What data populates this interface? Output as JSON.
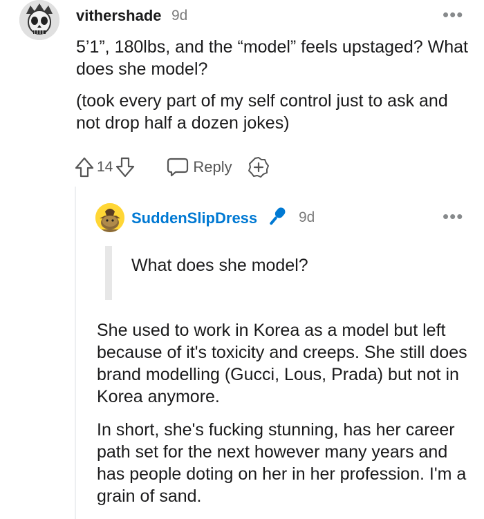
{
  "parent_comment": {
    "username": "vithershade",
    "time": "9d",
    "more_label": "•••",
    "paragraphs": [
      "5’1”, 180lbs, and the “model” feels upstaged? What does she model?",
      "(took every part of my self control just to ask and not drop half a dozen jokes)"
    ],
    "score": "14",
    "reply_label": "Reply",
    "icons": {
      "avatar": "skull-avatar-icon",
      "upvote": "arrow-up-icon",
      "downvote": "arrow-down-icon",
      "reply": "speech-bubble-icon",
      "award": "award-plus-icon"
    }
  },
  "reply_comment": {
    "username": "SuddenSlipDress",
    "time": "9d",
    "more_label": "•••",
    "quote": "What does she model?",
    "paragraphs": [
      "She used to work in Korea as a model but left because of it's toxicity and creeps. She still does brand modelling (Gucci, Lous, Prada) but not in Korea anymore.",
      "In short, she's fucking stunning, has her career path set for the next however many years and has people doting on her in her profession. I'm a grain of sand."
    ],
    "icons": {
      "avatar": "snoo-avatar-icon",
      "op_badge": "microphone-icon"
    },
    "colors": {
      "username": "#0079d3",
      "badge": "#0079d3"
    }
  }
}
